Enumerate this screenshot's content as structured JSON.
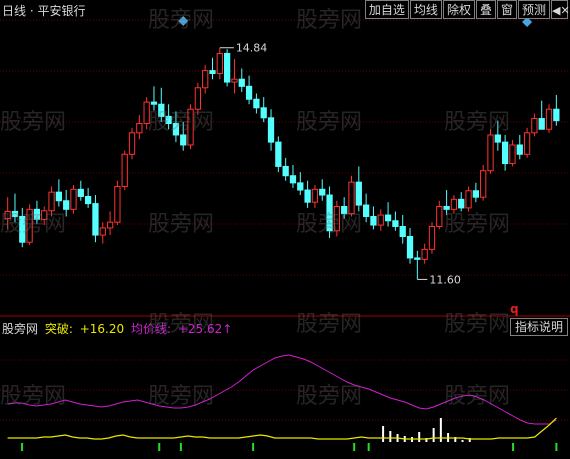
{
  "title": "日线 · 平安银行",
  "toolbar": {
    "add_watchlist": "加自选",
    "ma_line": "均线",
    "ex_rights": "除权",
    "overlay": "叠",
    "window": "窗",
    "forecast": "预测",
    "close_icon": "close-icon"
  },
  "price_annotations": {
    "high": "14.84",
    "low": "11.60"
  },
  "indicator": {
    "name": "股旁网",
    "break_label": "突破:",
    "break_value": "+16.20",
    "avg_label": "均价线:",
    "avg_value": "+25.62↑"
  },
  "help_button": "指标说明",
  "q_mark": "q",
  "watermark": "股旁网",
  "colors": {
    "up": "#ff3232",
    "down": "#54ffff",
    "avg_line": "#d020d0",
    "break_line": "#e8e800",
    "grid": "#6b0000"
  },
  "candles": [
    [
      12.45,
      12.75,
      12.3,
      12.55
    ],
    [
      12.55,
      12.8,
      12.4,
      12.48
    ],
    [
      12.48,
      12.6,
      12.05,
      12.12
    ],
    [
      12.12,
      12.65,
      12.08,
      12.58
    ],
    [
      12.58,
      12.7,
      12.38,
      12.44
    ],
    [
      12.44,
      12.62,
      12.36,
      12.56
    ],
    [
      12.56,
      12.9,
      12.48,
      12.82
    ],
    [
      12.82,
      13.0,
      12.62,
      12.7
    ],
    [
      12.7,
      12.85,
      12.48,
      12.58
    ],
    [
      12.58,
      12.92,
      12.52,
      12.86
    ],
    [
      12.86,
      12.98,
      12.7,
      12.76
    ],
    [
      12.76,
      12.88,
      12.6,
      12.66
    ],
    [
      12.66,
      12.78,
      12.12,
      12.22
    ],
    [
      12.22,
      12.4,
      12.1,
      12.32
    ],
    [
      12.32,
      12.55,
      12.22,
      12.4
    ],
    [
      12.4,
      12.98,
      12.36,
      12.9
    ],
    [
      12.9,
      13.4,
      12.85,
      13.35
    ],
    [
      13.35,
      13.72,
      13.28,
      13.65
    ],
    [
      13.65,
      13.9,
      13.56,
      13.78
    ],
    [
      13.78,
      14.15,
      13.7,
      14.08
    ],
    [
      14.08,
      14.3,
      13.96,
      14.05
    ],
    [
      14.05,
      14.28,
      13.8,
      13.88
    ],
    [
      13.88,
      14.05,
      13.7,
      13.78
    ],
    [
      13.78,
      13.95,
      13.52,
      13.62
    ],
    [
      13.62,
      13.8,
      13.4,
      13.48
    ],
    [
      13.48,
      14.05,
      13.42,
      13.98
    ],
    [
      13.98,
      14.35,
      13.9,
      14.28
    ],
    [
      14.28,
      14.6,
      14.2,
      14.52
    ],
    [
      14.52,
      14.7,
      14.4,
      14.48
    ],
    [
      14.48,
      14.84,
      14.4,
      14.76
    ],
    [
      14.76,
      14.82,
      14.3,
      14.36
    ],
    [
      14.36,
      14.68,
      14.2,
      14.4
    ],
    [
      14.4,
      14.55,
      14.22,
      14.3
    ],
    [
      14.3,
      14.45,
      14.05,
      14.12
    ],
    [
      14.12,
      14.2,
      13.92,
      14.0
    ],
    [
      14.0,
      14.15,
      13.8,
      13.86
    ],
    [
      13.86,
      13.98,
      13.4,
      13.52
    ],
    [
      13.52,
      13.6,
      13.1,
      13.18
    ],
    [
      13.18,
      13.3,
      12.98,
      13.05
    ],
    [
      13.05,
      13.2,
      12.88,
      12.95
    ],
    [
      12.95,
      13.1,
      12.78,
      12.85
    ],
    [
      12.85,
      12.98,
      12.6,
      12.68
    ],
    [
      12.68,
      12.92,
      12.6,
      12.86
    ],
    [
      12.86,
      13.0,
      12.7,
      12.78
    ],
    [
      12.78,
      12.9,
      12.18,
      12.28
    ],
    [
      12.28,
      12.7,
      12.2,
      12.62
    ],
    [
      12.62,
      12.75,
      12.45,
      12.52
    ],
    [
      12.52,
      13.05,
      12.48,
      12.96
    ],
    [
      12.96,
      13.18,
      12.55,
      12.64
    ],
    [
      12.64,
      12.8,
      12.4,
      12.48
    ],
    [
      12.48,
      12.62,
      12.3,
      12.36
    ],
    [
      12.36,
      12.58,
      12.28,
      12.5
    ],
    [
      12.5,
      12.68,
      12.34,
      12.42
    ],
    [
      12.42,
      12.55,
      12.28,
      12.34
    ],
    [
      12.34,
      12.5,
      12.1,
      12.2
    ],
    [
      12.2,
      12.32,
      11.82,
      11.9
    ],
    [
      11.9,
      12.0,
      11.6,
      11.88
    ],
    [
      11.88,
      12.1,
      11.82,
      12.02
    ],
    [
      12.02,
      12.4,
      11.96,
      12.34
    ],
    [
      12.34,
      12.7,
      12.3,
      12.62
    ],
    [
      12.62,
      12.85,
      12.5,
      12.58
    ],
    [
      12.58,
      12.78,
      12.52,
      12.72
    ],
    [
      12.72,
      12.82,
      12.55,
      12.6
    ],
    [
      12.6,
      12.9,
      12.55,
      12.84
    ],
    [
      12.84,
      12.95,
      12.68,
      12.75
    ],
    [
      12.75,
      13.2,
      12.7,
      13.12
    ],
    [
      13.12,
      13.7,
      13.08,
      13.62
    ],
    [
      13.62,
      13.82,
      13.4,
      13.52
    ],
    [
      13.52,
      13.62,
      13.12,
      13.22
    ],
    [
      13.22,
      13.55,
      13.18,
      13.48
    ],
    [
      13.48,
      13.62,
      13.28,
      13.35
    ],
    [
      13.35,
      13.72,
      13.3,
      13.65
    ],
    [
      13.65,
      13.92,
      13.6,
      13.85
    ],
    [
      13.85,
      14.1,
      13.8,
      13.7
    ],
    [
      13.7,
      14.05,
      13.65,
      13.98
    ],
    [
      13.98,
      14.18,
      13.75,
      13.82
    ]
  ],
  "price_range": [
    11.2,
    15.2
  ],
  "avg_series": [
    38,
    39,
    39,
    37,
    36,
    37,
    38,
    40,
    42,
    40,
    38,
    37,
    36,
    35,
    36,
    38,
    40,
    41,
    42,
    40,
    38,
    36,
    35,
    34,
    34,
    35,
    37,
    40,
    43,
    47,
    51,
    55,
    60,
    66,
    72,
    76,
    80,
    84,
    86,
    87,
    85,
    83,
    80,
    76,
    72,
    68,
    64,
    60,
    57,
    55,
    53,
    50,
    47,
    44,
    42,
    40,
    37,
    34,
    33,
    35,
    38,
    41,
    44,
    46,
    47,
    45,
    42,
    38,
    34,
    30,
    26,
    22,
    19,
    18,
    18,
    18,
    22
  ],
  "break_series": [
    4,
    4,
    4,
    4,
    4,
    5,
    5,
    6,
    7,
    5,
    4,
    4,
    3,
    3,
    4,
    6,
    7,
    5,
    4,
    4,
    4,
    4,
    4,
    4,
    5,
    6,
    5,
    5,
    4,
    4,
    4,
    4,
    4,
    5,
    6,
    7,
    6,
    4,
    4,
    4,
    4,
    4,
    4,
    3,
    3,
    3,
    3,
    3,
    4,
    5,
    4,
    4,
    4,
    4,
    4,
    3,
    3,
    3,
    3,
    4,
    4,
    4,
    4,
    4,
    3,
    3,
    3,
    3,
    4,
    4,
    4,
    4,
    4,
    5,
    11,
    17,
    24
  ],
  "vol_bars": [
    0,
    0,
    0,
    0,
    0,
    0,
    0,
    0,
    0,
    0,
    0,
    0,
    0,
    0,
    0,
    0,
    0,
    0,
    0,
    0,
    0,
    0,
    0,
    0,
    0,
    0,
    0,
    0,
    0,
    0,
    0,
    0,
    0,
    0,
    0,
    0,
    0,
    0,
    0,
    0,
    0,
    0,
    0,
    0,
    0,
    0,
    0,
    0,
    0,
    0,
    0,
    0,
    16,
    11,
    8,
    6,
    5,
    10,
    4,
    14,
    24,
    9,
    5,
    2,
    4,
    0,
    0,
    0,
    0,
    0,
    0,
    0,
    0,
    0,
    0,
    0
  ],
  "green_marks": [
    0,
    0,
    1,
    0,
    0,
    0,
    0,
    0,
    0,
    0,
    0,
    0,
    0,
    0,
    0,
    0,
    0,
    0,
    0,
    0,
    0,
    1,
    0,
    0,
    1,
    0,
    0,
    0,
    0,
    0,
    0,
    0,
    0,
    0,
    1,
    0,
    0,
    0,
    0,
    0,
    0,
    0,
    0,
    0,
    0,
    0,
    0,
    0,
    1,
    0,
    1,
    0,
    0,
    0,
    0,
    0,
    0,
    0,
    0,
    0,
    0,
    0,
    0,
    0,
    0,
    0,
    0,
    0,
    0,
    0,
    1,
    0,
    0,
    0,
    0,
    0,
    1
  ]
}
